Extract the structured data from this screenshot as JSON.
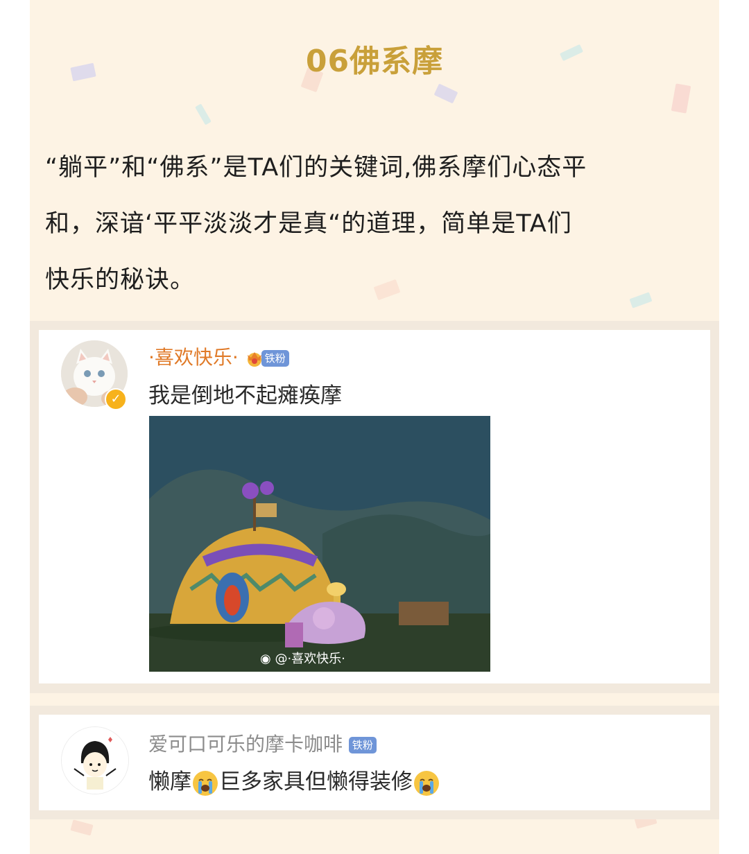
{
  "section": {
    "title": "06佛系摩",
    "title_color": "#c9a03a",
    "lines": [
      "“躺平”和“佛系”是TA们的关键词,佛系摩们心态平",
      "和，深谙‘平平淡淡才是真“的道理，简单是TA们",
      "快乐的秘诀。"
    ]
  },
  "comments": [
    {
      "username": "·喜欢快乐·",
      "username_color": "#e07a28",
      "badge": "铁粉",
      "text": "我是倒地不起瘫痪摩",
      "image_watermark": "@·喜欢快乐·",
      "avatar_icon": "cat-avatar",
      "verified_icon": "verified-icon"
    },
    {
      "username": "爱可口可乐的摩卡咖啡",
      "username_color": "#8c8c8c",
      "badge": "铁粉",
      "text_part1": "懒摩",
      "text_part2": "巨多家具但懒得装修",
      "emoji_icon": "crying-face-icon",
      "avatar_icon": "cartoon-girl-avatar"
    }
  ]
}
